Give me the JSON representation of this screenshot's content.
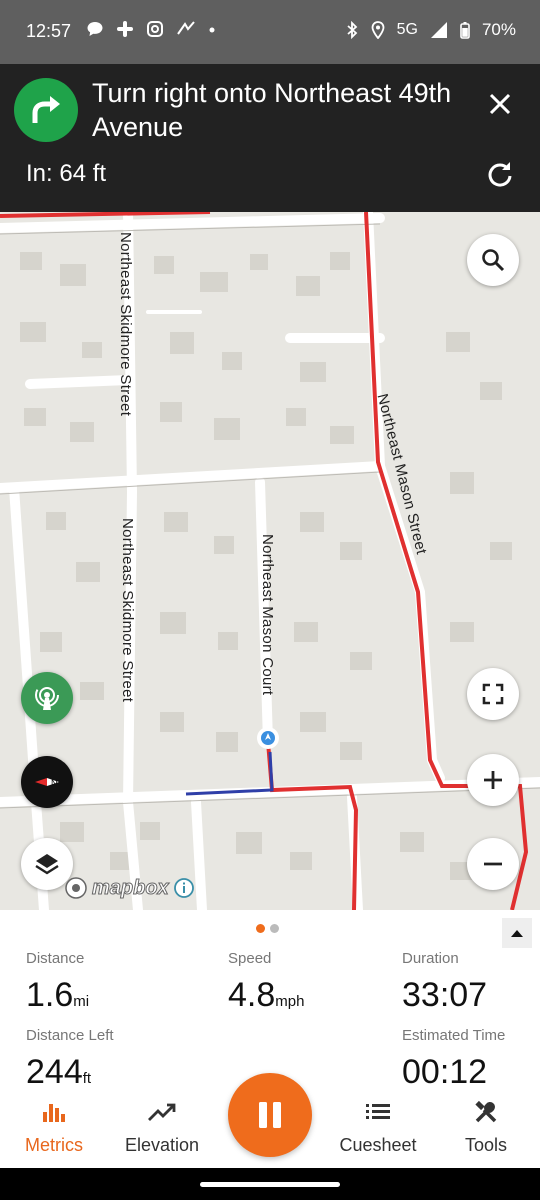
{
  "status_bar": {
    "time": "12:57",
    "network": "5G",
    "battery": "70%",
    "left_icons": [
      "chat-bubble-icon",
      "slack-icon",
      "instagram-icon",
      "strava-icon",
      "dot-icon"
    ],
    "right_icons": [
      "bluetooth-icon",
      "location-icon",
      "signal-icon",
      "battery-icon"
    ]
  },
  "navigation": {
    "instruction": "Turn right onto Northeast 49th Avenue",
    "distance": "In: 64 ft",
    "turn_icon": "turn-right-arrow-icon",
    "turn_color": "#1fa34a"
  },
  "map": {
    "street_labels": {
      "skidmore_top": "Northeast Skidmore Street",
      "skidmore_bottom": "Northeast Skidmore Street",
      "mason_court": "Northeast Mason Court",
      "mason_street": "Northeast Mason Street"
    },
    "attribution": "mapbox",
    "route_color": "#e03030",
    "active_segment_color": "#2f3fa8"
  },
  "metrics": {
    "distance": {
      "label": "Distance",
      "value": "1.6",
      "unit": "mi"
    },
    "speed": {
      "label": "Speed",
      "value": "4.8",
      "unit": "mph"
    },
    "duration": {
      "label": "Duration",
      "value": "33:07"
    },
    "distance_left": {
      "label": "Distance Left",
      "value": "244",
      "unit": "ft"
    },
    "estimated_time": {
      "label": "Estimated Time",
      "value": "00:12"
    },
    "page_indicator": {
      "pages": 2,
      "active": 1
    }
  },
  "bottom_nav": {
    "metrics": "Metrics",
    "elevation": "Elevation",
    "cuesheet": "Cuesheet",
    "tools": "Tools",
    "accent": "#e8671d"
  }
}
